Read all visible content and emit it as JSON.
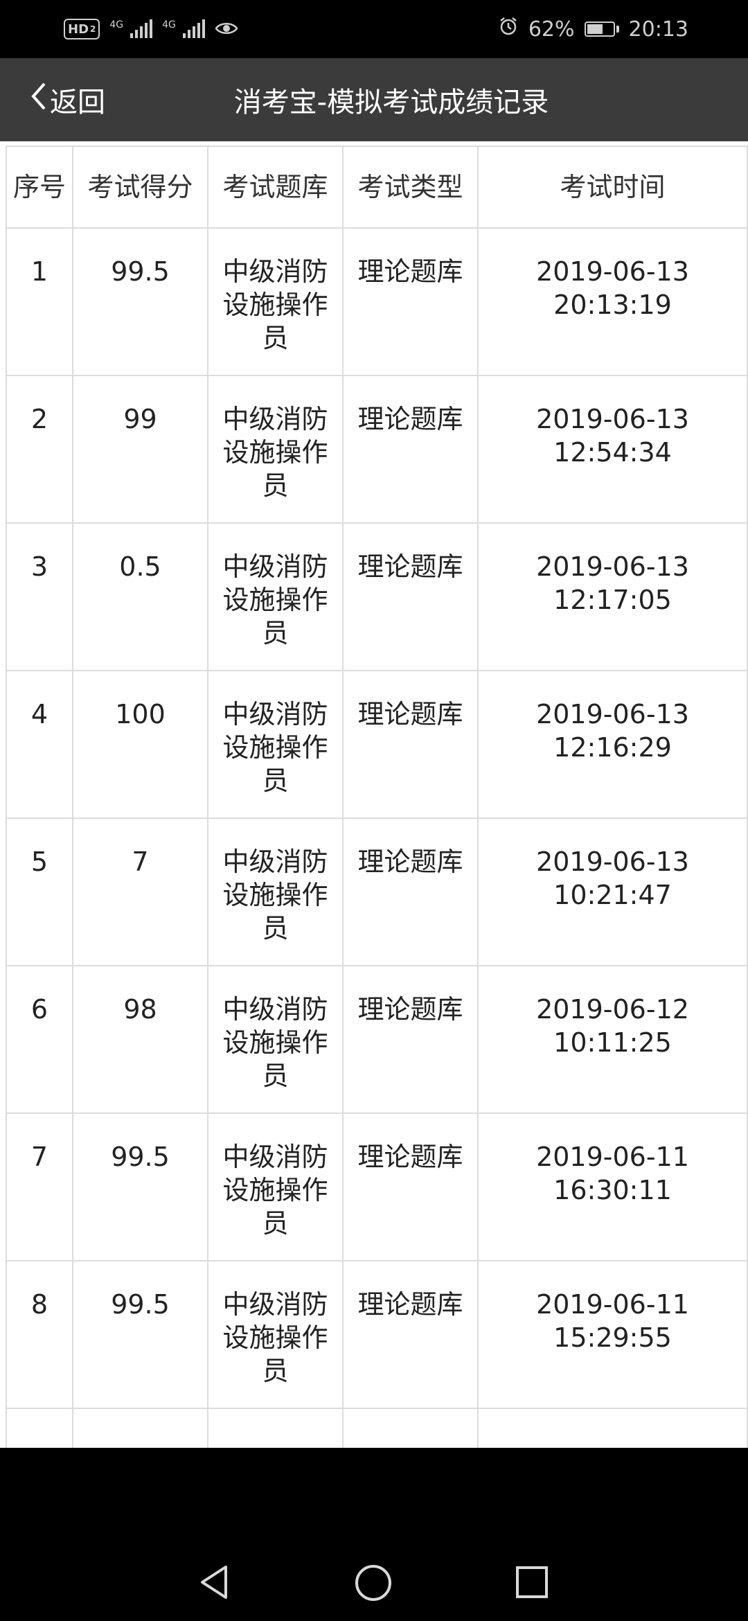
{
  "status_bar": {
    "hd": "HD",
    "hd_sub": "2",
    "net1": "4G",
    "net2": "4G",
    "alarm_icon": "alarm-icon",
    "battery_percent": "62%",
    "battery_level": 0.62,
    "time": "20:13"
  },
  "header": {
    "back_label": "返回",
    "title": "消考宝-模拟考试成绩记录"
  },
  "table": {
    "columns": [
      "序号",
      "考试得分",
      "考试题库",
      "考试类型",
      "考试时间"
    ],
    "rows": [
      {
        "no": "1",
        "score": "99.5",
        "bank": "中级消防设施操作员",
        "type": "理论题库",
        "date": "2019-06-13",
        "time": "20:13:19"
      },
      {
        "no": "2",
        "score": "99",
        "bank": "中级消防设施操作员",
        "type": "理论题库",
        "date": "2019-06-13",
        "time": "12:54:34"
      },
      {
        "no": "3",
        "score": "0.5",
        "bank": "中级消防设施操作员",
        "type": "理论题库",
        "date": "2019-06-13",
        "time": "12:17:05"
      },
      {
        "no": "4",
        "score": "100",
        "bank": "中级消防设施操作员",
        "type": "理论题库",
        "date": "2019-06-13",
        "time": "12:16:29"
      },
      {
        "no": "5",
        "score": "7",
        "bank": "中级消防设施操作员",
        "type": "理论题库",
        "date": "2019-06-13",
        "time": "10:21:47"
      },
      {
        "no": "6",
        "score": "98",
        "bank": "中级消防设施操作员",
        "type": "理论题库",
        "date": "2019-06-12",
        "time": "10:11:25"
      },
      {
        "no": "7",
        "score": "99.5",
        "bank": "中级消防设施操作员",
        "type": "理论题库",
        "date": "2019-06-11",
        "time": "16:30:11"
      },
      {
        "no": "8",
        "score": "99.5",
        "bank": "中级消防设施操作员",
        "type": "理论题库",
        "date": "2019-06-11",
        "time": "15:29:55"
      }
    ]
  },
  "nav": {
    "back_icon": "triangle-back-icon",
    "home_icon": "circle-home-icon",
    "recents_icon": "square-recents-icon"
  }
}
